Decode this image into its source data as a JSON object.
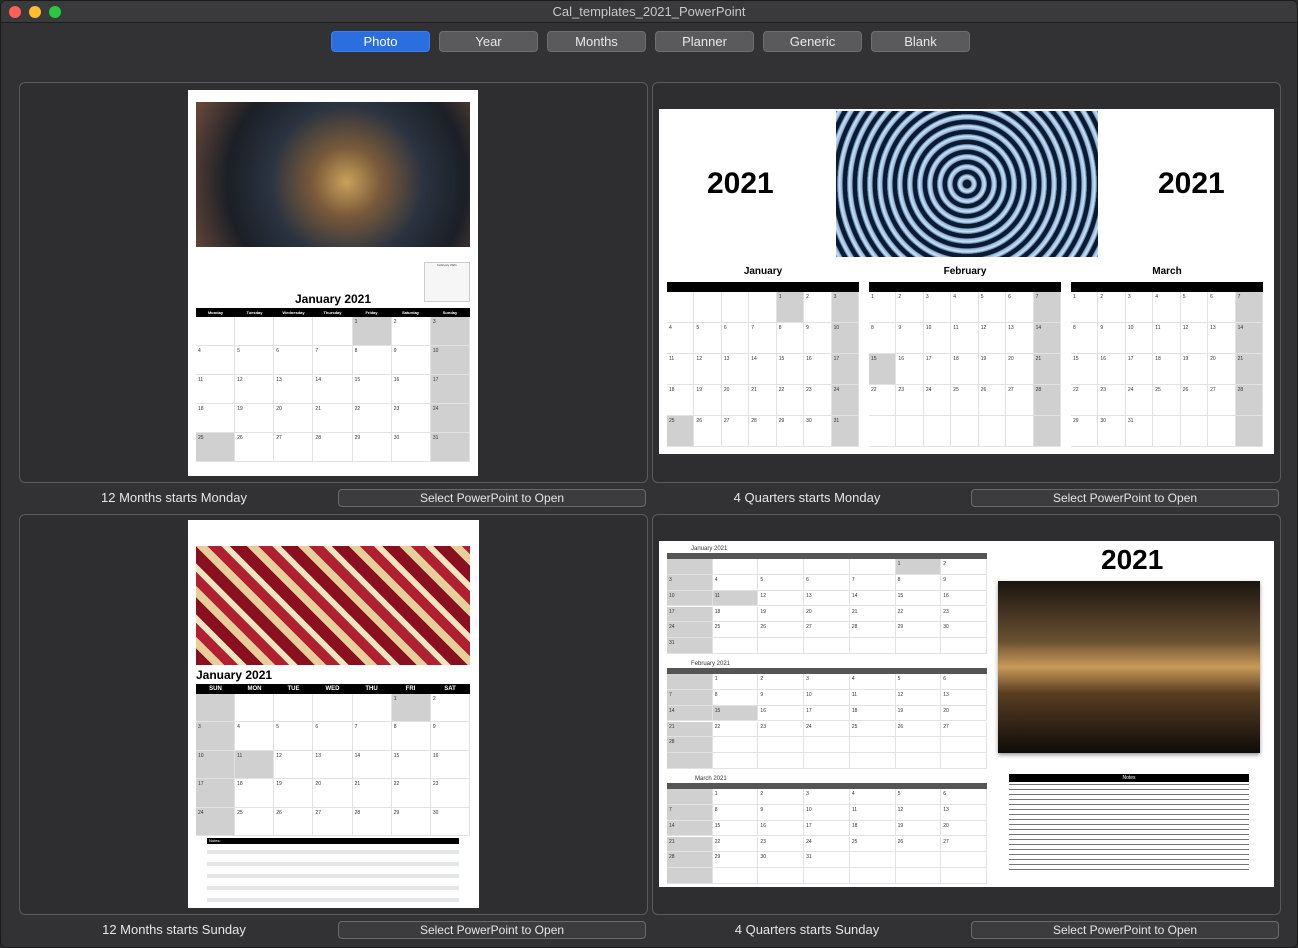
{
  "window": {
    "title": "Cal_templates_2021_PowerPoint"
  },
  "tabs": [
    {
      "label": "Photo",
      "active": true
    },
    {
      "label": "Year",
      "active": false
    },
    {
      "label": "Months",
      "active": false
    },
    {
      "label": "Planner",
      "active": false
    },
    {
      "label": "Generic",
      "active": false
    },
    {
      "label": "Blank",
      "active": false
    }
  ],
  "templates": [
    {
      "caption": "12 Months starts Monday",
      "button": "Select PowerPoint to Open"
    },
    {
      "caption": "4 Quarters starts Monday",
      "button": "Select PowerPoint to Open"
    },
    {
      "caption": "12 Months starts Sunday",
      "button": "Select PowerPoint to Open"
    },
    {
      "caption": "4 Quarters starts Sunday",
      "button": "Select PowerPoint to Open"
    }
  ],
  "thumb1": {
    "month": "January 2021",
    "mini": "February 2021",
    "days": [
      "Monday",
      "Tuesday",
      "Wednesday",
      "Thursday",
      "Friday",
      "Saturday",
      "Sunday"
    ]
  },
  "thumb2": {
    "year_left": "2021",
    "year_right": "2021",
    "months": [
      "January",
      "February",
      "March"
    ],
    "days": [
      "Monday",
      "Tuesday",
      "Wednesday",
      "Thursday",
      "Friday",
      "Saturday",
      "Sunday"
    ]
  },
  "thumb3": {
    "month": "January 2021",
    "days": [
      "SUN",
      "MON",
      "TUE",
      "WED",
      "THU",
      "FRI",
      "SAT"
    ],
    "notes": "Notes:"
  },
  "thumb4": {
    "year": "2021",
    "months": [
      "January 2021",
      "February 2021",
      "March 2021"
    ],
    "days": [
      "SUN",
      "MON",
      "TUE",
      "WED",
      "THU",
      "FRI",
      "SAT"
    ],
    "notes": "Notes"
  },
  "colors": {
    "accent": "#2a6ee0"
  }
}
